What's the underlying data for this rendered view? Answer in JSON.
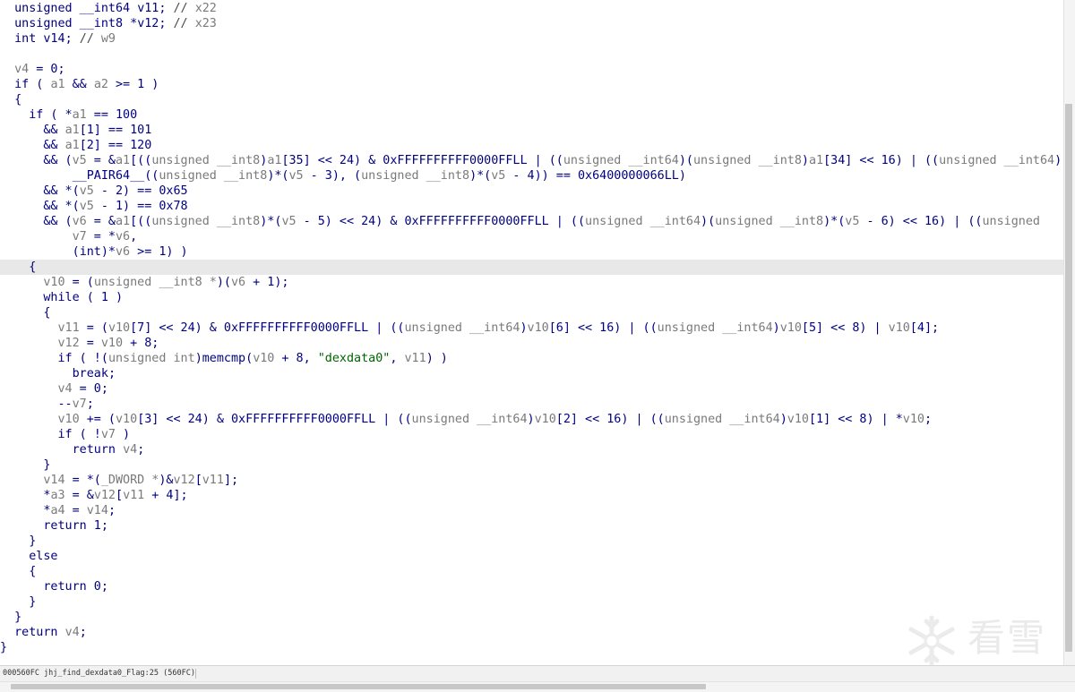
{
  "editor": {
    "lines": [
      [
        [
          "k",
          "  unsigned __int64 "
        ],
        [
          "v",
          "v11"
        ],
        [
          "p",
          "; "
        ],
        [
          "c",
          "// "
        ],
        [
          "g",
          "x22"
        ]
      ],
      [
        [
          "k",
          "  unsigned __int8 *"
        ],
        [
          "v",
          "v12"
        ],
        [
          "p",
          "; "
        ],
        [
          "c",
          "// "
        ],
        [
          "g",
          "x23"
        ]
      ],
      [
        [
          "k",
          "  int "
        ],
        [
          "v",
          "v14"
        ],
        [
          "p",
          "; "
        ],
        [
          "c",
          "// "
        ],
        [
          "g",
          "w9"
        ]
      ],
      [],
      [
        [
          "g",
          "  v4"
        ],
        [
          "p",
          " = 0;"
        ]
      ],
      [
        [
          "k",
          "  if"
        ],
        [
          "p",
          " ( "
        ],
        [
          "g",
          "a1"
        ],
        [
          "p",
          " && "
        ],
        [
          "g",
          "a2"
        ],
        [
          "p",
          " >= 1 )"
        ]
      ],
      [
        [
          "p",
          "  {"
        ]
      ],
      [
        [
          "k",
          "    if"
        ],
        [
          "p",
          " ( *"
        ],
        [
          "g",
          "a1"
        ],
        [
          "p",
          " == 100"
        ]
      ],
      [
        [
          "p",
          "      && "
        ],
        [
          "g",
          "a1"
        ],
        [
          "p",
          "[1] == 101"
        ]
      ],
      [
        [
          "p",
          "      && "
        ],
        [
          "g",
          "a1"
        ],
        [
          "p",
          "[2] == 120"
        ]
      ],
      [
        [
          "p",
          "      && ("
        ],
        [
          "g",
          "v5"
        ],
        [
          "p",
          " = &"
        ],
        [
          "g",
          "a1"
        ],
        [
          "p",
          "[(("
        ],
        [
          "g",
          "unsigned __int8"
        ],
        [
          "p",
          ")"
        ],
        [
          "g",
          "a1"
        ],
        [
          "p",
          "[35] << 24) & 0xFFFFFFFFFF0000FFLL | (("
        ],
        [
          "g",
          "unsigned __int64"
        ],
        [
          "p",
          ")("
        ],
        [
          "g",
          "unsigned __int8"
        ],
        [
          "p",
          ")"
        ],
        [
          "g",
          "a1"
        ],
        [
          "p",
          "[34] << 16) | (("
        ],
        [
          "g",
          "unsigned __int64"
        ],
        [
          "p",
          ")(unsigned"
        ]
      ],
      [
        [
          "p",
          "          __PAIR64__(("
        ],
        [
          "g",
          "unsigned __int8"
        ],
        [
          "p",
          ")*("
        ],
        [
          "g",
          "v5"
        ],
        [
          "p",
          " - 3), ("
        ],
        [
          "g",
          "unsigned __int8"
        ],
        [
          "p",
          ")*("
        ],
        [
          "g",
          "v5"
        ],
        [
          "p",
          " - 4)) == 0x6400000066LL)"
        ]
      ],
      [
        [
          "p",
          "      && *("
        ],
        [
          "g",
          "v5"
        ],
        [
          "p",
          " - 2) == 0x65"
        ]
      ],
      [
        [
          "p",
          "      && *("
        ],
        [
          "g",
          "v5"
        ],
        [
          "p",
          " - 1) == 0x78"
        ]
      ],
      [
        [
          "p",
          "      && ("
        ],
        [
          "g",
          "v6"
        ],
        [
          "p",
          " = &"
        ],
        [
          "g",
          "a1"
        ],
        [
          "p",
          "[(("
        ],
        [
          "g",
          "unsigned __int8"
        ],
        [
          "p",
          ")*("
        ],
        [
          "g",
          "v5"
        ],
        [
          "p",
          " - 5) << 24) & 0xFFFFFFFFFF0000FFLL | (("
        ],
        [
          "g",
          "unsigned __int64"
        ],
        [
          "p",
          ")("
        ],
        [
          "g",
          "unsigned __int8"
        ],
        [
          "p",
          ")*("
        ],
        [
          "g",
          "v5"
        ],
        [
          "p",
          " - 6) << 16) | (("
        ],
        [
          "g",
          "unsigned"
        ]
      ],
      [
        [
          "p",
          "          "
        ],
        [
          "g",
          "v7"
        ],
        [
          "p",
          " = *"
        ],
        [
          "g",
          "v6"
        ],
        [
          "p",
          ","
        ]
      ],
      [
        [
          "p",
          "          ("
        ],
        [
          "k",
          "int"
        ],
        [
          "p",
          ")*"
        ],
        [
          "g",
          "v6"
        ],
        [
          "p",
          " >= 1) )"
        ]
      ],
      [
        [
          "p",
          "    {"
        ]
      ],
      [
        [
          "g",
          "      v10"
        ],
        [
          "p",
          " = ("
        ],
        [
          "g",
          "unsigned __int8 *"
        ],
        [
          "p",
          ")("
        ],
        [
          "g",
          "v6"
        ],
        [
          "p",
          " + 1);"
        ]
      ],
      [
        [
          "k",
          "      while"
        ],
        [
          "p",
          " ( 1 )"
        ]
      ],
      [
        [
          "p",
          "      {"
        ]
      ],
      [
        [
          "g",
          "        v11"
        ],
        [
          "p",
          " = ("
        ],
        [
          "g",
          "v10"
        ],
        [
          "p",
          "[7] << 24) & 0xFFFFFFFFFF0000FFLL | (("
        ],
        [
          "g",
          "unsigned __int64"
        ],
        [
          "p",
          ")"
        ],
        [
          "g",
          "v10"
        ],
        [
          "p",
          "[6] << 16) | (("
        ],
        [
          "g",
          "unsigned __int64"
        ],
        [
          "p",
          ")"
        ],
        [
          "g",
          "v10"
        ],
        [
          "p",
          "[5] << 8) | "
        ],
        [
          "g",
          "v10"
        ],
        [
          "p",
          "[4];"
        ]
      ],
      [
        [
          "g",
          "        v12"
        ],
        [
          "p",
          " = "
        ],
        [
          "g",
          "v10"
        ],
        [
          "p",
          " + 8;"
        ]
      ],
      [
        [
          "k",
          "        if"
        ],
        [
          "p",
          " ( !("
        ],
        [
          "g",
          "unsigned int"
        ],
        [
          "p",
          ")memcmp("
        ],
        [
          "g",
          "v10"
        ],
        [
          "p",
          " + 8, "
        ],
        [
          "s",
          "\"dexdata0\""
        ],
        [
          "p",
          ", "
        ],
        [
          "g",
          "v11"
        ],
        [
          "p",
          ") )"
        ]
      ],
      [
        [
          "k",
          "          break"
        ],
        [
          "p",
          ";"
        ]
      ],
      [
        [
          "g",
          "        v4"
        ],
        [
          "p",
          " = 0;"
        ]
      ],
      [
        [
          "p",
          "        --"
        ],
        [
          "g",
          "v7"
        ],
        [
          "p",
          ";"
        ]
      ],
      [
        [
          "g",
          "        v10"
        ],
        [
          "p",
          " += ("
        ],
        [
          "g",
          "v10"
        ],
        [
          "p",
          "[3] << 24) & 0xFFFFFFFFFF0000FFLL | (("
        ],
        [
          "g",
          "unsigned __int64"
        ],
        [
          "p",
          ")"
        ],
        [
          "g",
          "v10"
        ],
        [
          "p",
          "[2] << 16) | (("
        ],
        [
          "g",
          "unsigned __int64"
        ],
        [
          "p",
          ")"
        ],
        [
          "g",
          "v10"
        ],
        [
          "p",
          "[1] << 8) | *"
        ],
        [
          "g",
          "v10"
        ],
        [
          "p",
          ";"
        ]
      ],
      [
        [
          "k",
          "        if"
        ],
        [
          "p",
          " ( !"
        ],
        [
          "g",
          "v7"
        ],
        [
          "p",
          " )"
        ]
      ],
      [
        [
          "k",
          "          return "
        ],
        [
          "g",
          "v4"
        ],
        [
          "p",
          ";"
        ]
      ],
      [
        [
          "p",
          "      }"
        ]
      ],
      [
        [
          "g",
          "      v14"
        ],
        [
          "p",
          " = *("
        ],
        [
          "g",
          "_DWORD *"
        ],
        [
          "p",
          ")&"
        ],
        [
          "g",
          "v12"
        ],
        [
          "p",
          "["
        ],
        [
          "g",
          "v11"
        ],
        [
          "p",
          "];"
        ]
      ],
      [
        [
          "p",
          "      *"
        ],
        [
          "g",
          "a3"
        ],
        [
          "p",
          " = &"
        ],
        [
          "g",
          "v12"
        ],
        [
          "p",
          "["
        ],
        [
          "g",
          "v11"
        ],
        [
          "p",
          " + 4];"
        ]
      ],
      [
        [
          "p",
          "      *"
        ],
        [
          "g",
          "a4"
        ],
        [
          "p",
          " = "
        ],
        [
          "g",
          "v14"
        ],
        [
          "p",
          ";"
        ]
      ],
      [
        [
          "k",
          "      return"
        ],
        [
          "p",
          " 1;"
        ]
      ],
      [
        [
          "p",
          "    }"
        ]
      ],
      [
        [
          "k",
          "    else"
        ]
      ],
      [
        [
          "p",
          "    {"
        ]
      ],
      [
        [
          "k",
          "      return"
        ],
        [
          "p",
          " 0;"
        ]
      ],
      [
        [
          "p",
          "    }"
        ]
      ],
      [
        [
          "p",
          "  }"
        ]
      ],
      [
        [
          "k",
          "  return "
        ],
        [
          "g",
          "v4"
        ],
        [
          "p",
          ";"
        ]
      ],
      [
        [
          "p",
          "}"
        ]
      ]
    ],
    "current_line_index": 17
  },
  "status_bar": {
    "text": "000560FC jhj_find_dexdata0_Flag:25 (560FC)"
  },
  "watermark": {
    "text": "看雪",
    "logo_icon": "snowflake-icon"
  },
  "colors": {
    "keyword": "#000080",
    "variable": "#7a7a7a",
    "string": "#006400",
    "current_line_bg": "#e8e8e8"
  }
}
